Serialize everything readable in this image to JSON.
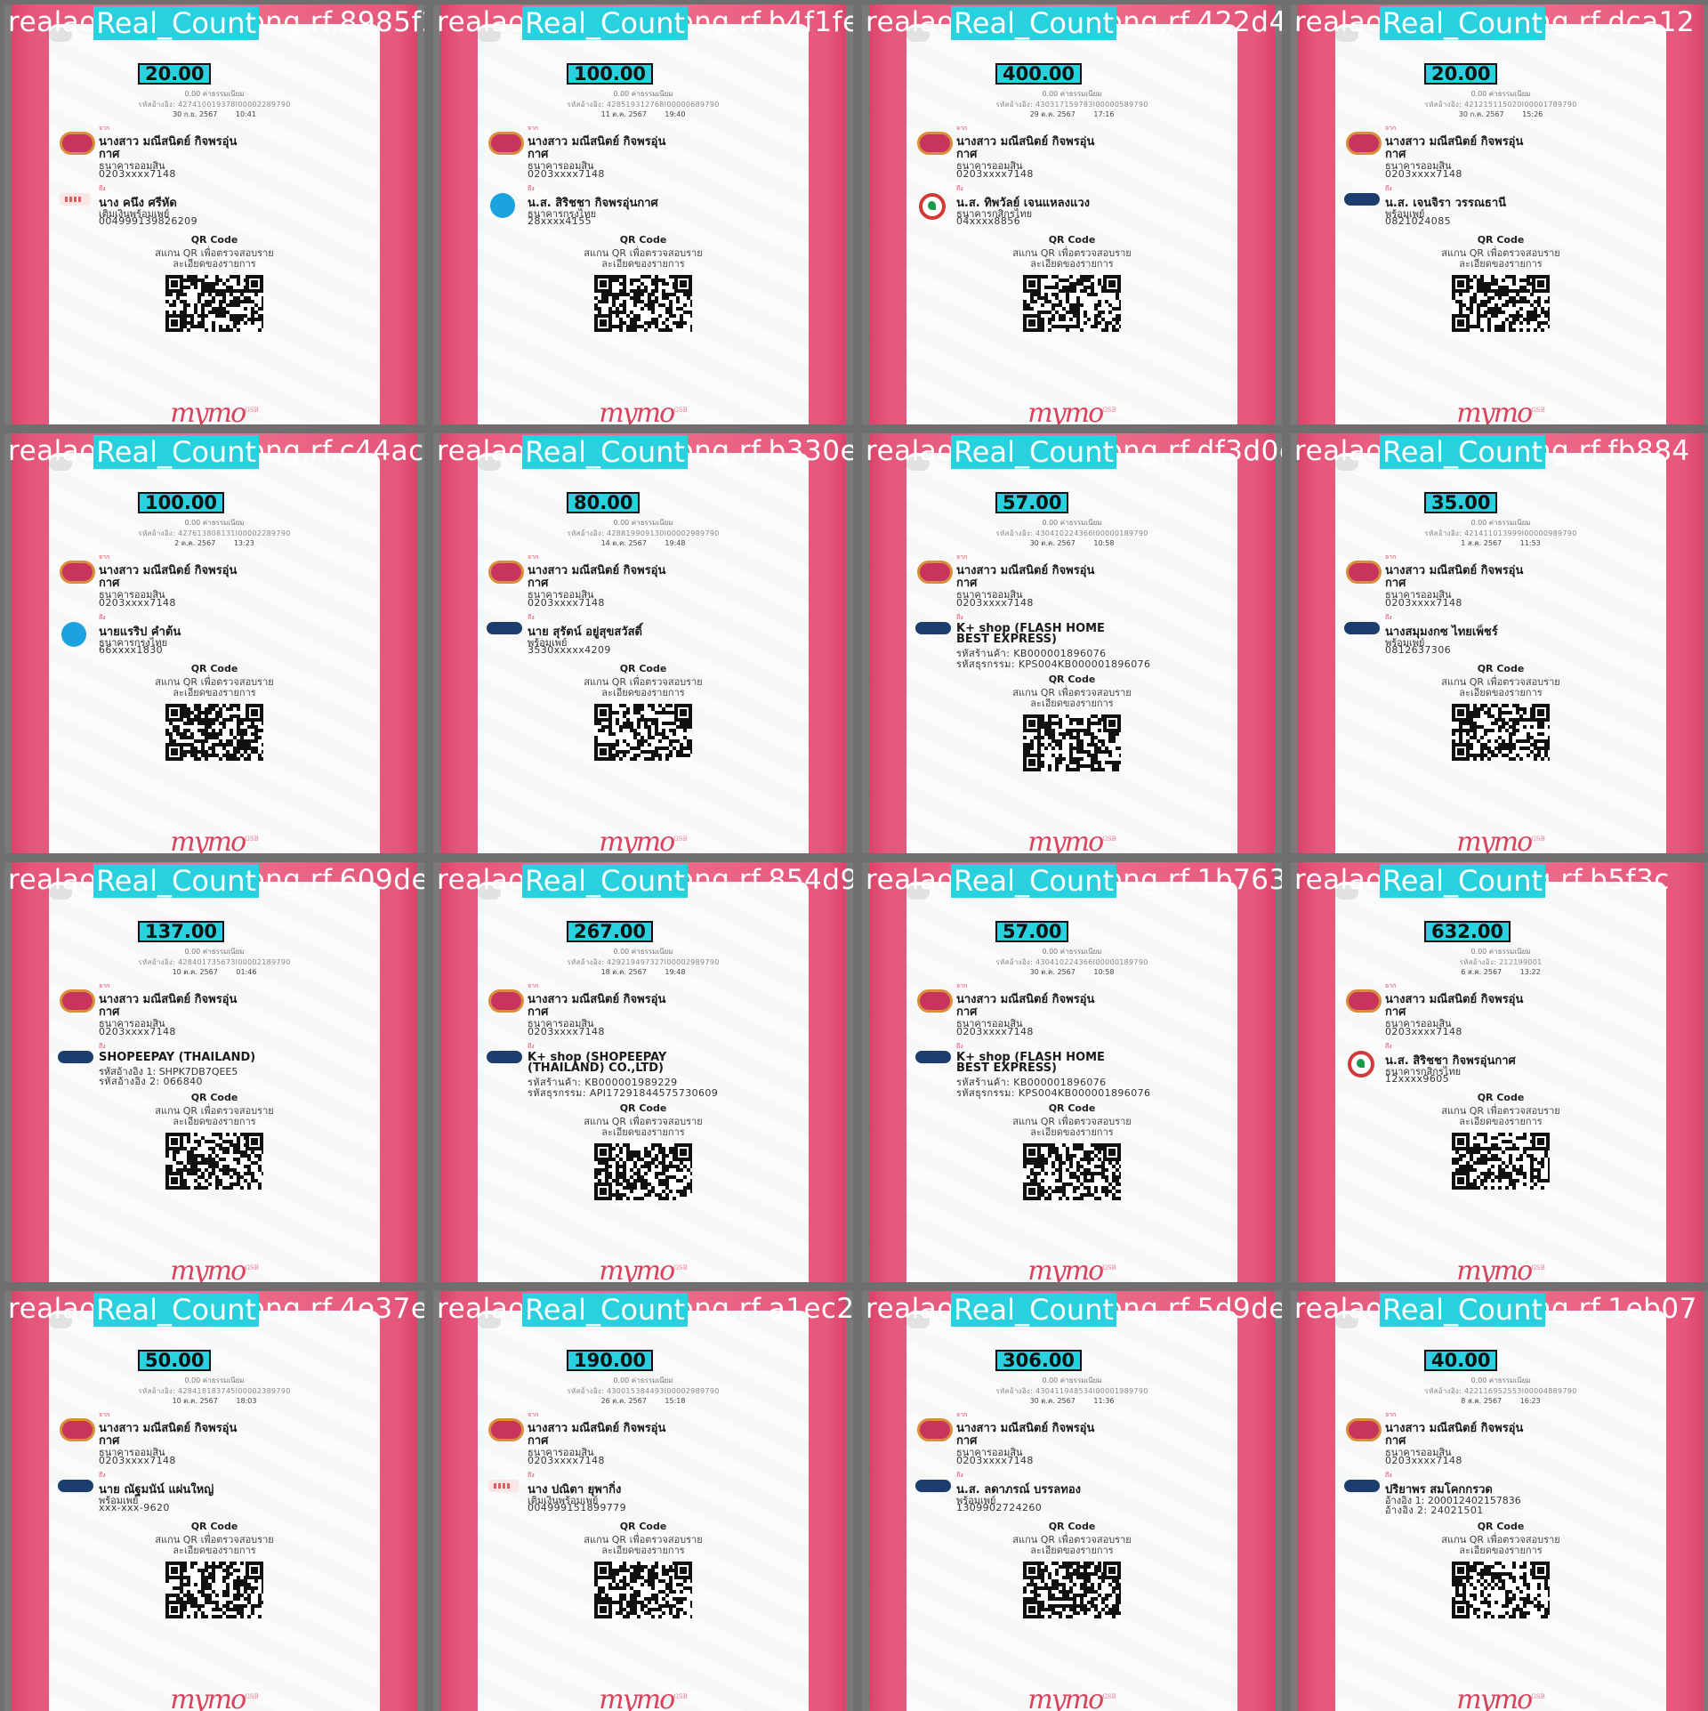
{
  "class_label": "Real_Count",
  "extra_text": "0.00 ค่าธรรมเนียม",
  "from_label": "จาก",
  "to_label": "ถึง",
  "sender": {
    "name_line1": "นางสาว มณีสนิตย์ กิจพรอุ่น",
    "name_line2": "กาศ",
    "bank": "ธนาคารออมสิน",
    "account": "0203xxxx7148"
  },
  "qr_section": {
    "title": "QR Code",
    "desc_line1": "สแกน QR เพื่อตรวจสอบราย",
    "desc_line2": "ละเอียดของรายการ"
  },
  "brand": {
    "name": "mymo",
    "sup": "GSB"
  },
  "tiles": [
    {
      "filename": "realaomsin_173_png.rf.8985f2a7f792af97",
      "amount": "20.00",
      "ref": "รหัสอ้างอิง: 427410019378I00002289790",
      "date": "30 ก.ย. 2567",
      "time": "10:41",
      "recipient_logo": "truemoney",
      "recipient_name": "นาง คนึง ศรีหัด",
      "recipient_line2": "เติมเงินพร้อมเพย์",
      "recipient_line3": "004999139826209",
      "recipient_line4": ""
    },
    {
      "filename": "realaomsin_178_png.rf.b4f1feadb1d4c607",
      "amount": "100.00",
      "ref": "รหัสอ้างอิง: 428519312768I00000689790",
      "date": "11 ต.ค. 2567",
      "time": "19:40",
      "recipient_logo": "ktb",
      "recipient_name": "น.ส. สิริชชา กิจพรอุ่นกาศ",
      "recipient_line2": "ธนาคารกรุงไทย",
      "recipient_line3": "28xxxx4155",
      "recipient_line4": ""
    },
    {
      "filename": "realaomsin_184_png.rf.422d4535a0a9e1b6",
      "amount": "400.00",
      "ref": "รหัสอ้างอิง: 430317159783I00000589790",
      "date": "29 ต.ค. 2567",
      "time": "17:16",
      "recipient_logo": "kbank",
      "recipient_name": "น.ส. ทิพวัลย์ เจนแหลงแวง",
      "recipient_line2": "ธนาคารกสิกรไทย",
      "recipient_line3": "04xxxx8856",
      "recipient_line4": ""
    },
    {
      "filename": "realaomsin_18_png.rf.dca12",
      "amount": "20.00",
      "ref": "รหัสอ้างอิง: 421215115020I00001789790",
      "date": "30 ก.ค. 2567",
      "time": "15:26",
      "recipient_logo": "promptpay",
      "recipient_name": "น.ส. เจนจิรา วรรณธานี",
      "recipient_line2": "พร้อมเพย์",
      "recipient_line3": "0821024085",
      "recipient_line4": ""
    },
    {
      "filename": "realaomsin_186_png.rf.c44ac85eff1923c540",
      "amount": "100.00",
      "ref": "รหัสอ้างอิง: 427613808131I00002289790",
      "date": "2 ต.ค. 2567",
      "time": "13:23",
      "recipient_logo": "ktb",
      "recipient_name": "นายแรริป คำต้น",
      "recipient_line2": "ธนาคารกรุงไทย",
      "recipient_line3": "66xxxx1830",
      "recipient_line4": ""
    },
    {
      "filename": "realaomsin_187_png.rf.b330e75662e1ac195",
      "amount": "80.00",
      "ref": "รหัสอ้างอิง: 428819909130I00002989790",
      "date": "14 ต.ค. 2567",
      "time": "19:48",
      "recipient_logo": "promptpay",
      "recipient_name": "นาย สุรัตน์ อยู่สุขสวัสดิ์",
      "recipient_line2": "พร้อมเพย์",
      "recipient_line3": "3530xxxxx4209",
      "recipient_line4": ""
    },
    {
      "filename": "realaomsin_189_png.rf.df3d0e3f3bf1c8",
      "amount": "57.00",
      "ref": "รหัสอ้างอิง: 430410224366I00000189790",
      "date": "30 ต.ค. 2567",
      "time": "10:58",
      "recipient_logo": "promptpay",
      "recipient_name": "K+ shop (FLASH HOME",
      "recipient_line2": "BEST EXPRESS)",
      "recipient_line3": "รหัสร้านค้า: KB000001896076",
      "recipient_line4": "รหัสธุรกรรม: KPS004KB000001896076"
    },
    {
      "filename": "realaomsin_19_png.rf.fb884",
      "amount": "35.00",
      "ref": "รหัสอ้างอิง: 421411013999I00000989790",
      "date": "1 ส.ค. 2567",
      "time": "11:53",
      "recipient_logo": "promptpay",
      "recipient_name": "นางสมุมงกซ ไทยเพ็ชร์",
      "recipient_line2": "พร้อมเพย์",
      "recipient_line3": "0812637306",
      "recipient_line4": ""
    },
    {
      "filename": "realaomsin_190_png.rf.609de0af2bd7f1620",
      "amount": "137.00",
      "ref": "รหัสอ้างอิง: 428401735673I00002189790",
      "date": "10 ต.ค. 2567",
      "time": "01:46",
      "recipient_logo": "promptpay",
      "recipient_name": "SHOPEEPAY (THAILAND)",
      "recipient_line2": "รหัสอ้างอิง 1: SHPK7DB7QEE5",
      "recipient_line3": "รหัสอ้างอิง 2: 066840",
      "recipient_line4": ""
    },
    {
      "filename": "realaomsin_193_png.rf.854d9e1acb3f3f2a6",
      "amount": "267.00",
      "ref": "รหัสอ้างอิง: 429219497327I00002989790",
      "date": "18 ต.ค. 2567",
      "time": "19:48",
      "recipient_logo": "promptpay",
      "recipient_name": "K+ shop (SHOPEEPAY",
      "recipient_line2": "(THAILAND) CO.,LTD)",
      "recipient_line3": "รหัสร้านค้า: KB000001989229",
      "recipient_line4": "รหัสธุรกรรม: API17291844575730609"
    },
    {
      "filename": "realaomsin_196_png.rf.1b76350abad8e7c1",
      "amount": "57.00",
      "ref": "รหัสอ้างอิง: 430410224366I00000189790",
      "date": "30 ต.ค. 2567",
      "time": "10:58",
      "recipient_logo": "promptpay",
      "recipient_name": "K+ shop (FLASH HOME",
      "recipient_line2": "BEST EXPRESS)",
      "recipient_line3": "รหัสร้านค้า: KB000001896076",
      "recipient_line4": "รหัสธุรกรรม: KPS004KB000001896076"
    },
    {
      "filename": "realaomsin_1_png.rf.b5f3c",
      "amount": "632.00",
      "ref": "รหัสอ้างอิง: 212199001",
      "date": "6 ส.ค. 2567",
      "time": "13:22",
      "recipient_logo": "kbank",
      "recipient_name": "น.ส. สิริชชา กิจพรอุ่นกาศ",
      "recipient_line2": "ธนาคารกสิกรไทย",
      "recipient_line3": "12xxxx9605",
      "recipient_line4": ""
    },
    {
      "filename": "realaomsin_203_png.rf.4e37e10d756f0f2d1",
      "amount": "50.00",
      "ref": "รหัสอ้างอิง: 428418183745I00002389790",
      "date": "10 ต.ค. 2567",
      "time": "18:03",
      "recipient_logo": "promptpay",
      "recipient_name": "นาย ณัฐมนัน์ แผ่นใหญ่",
      "recipient_line2": "พร้อมเพย์",
      "recipient_line3": "xxx-xxx-9620",
      "recipient_line4": ""
    },
    {
      "filename": "realaomsin_205_png.rf.a1ec298a25dd127e9",
      "amount": "190.00",
      "ref": "รหัสอ้างอิง: 430015384493I00002989790",
      "date": "26 ต.ค. 2567",
      "time": "15:18",
      "recipient_logo": "truemoney",
      "recipient_name": "นาง ปณิตา ยุพากิ่ง",
      "recipient_line2": "เติมเงินพร้อมเพย์",
      "recipient_line3": "004999151899779",
      "recipient_line4": ""
    },
    {
      "filename": "realaomsin_207_png.rf.5d9de15ebd6b19354",
      "amount": "306.00",
      "ref": "รหัสอ้างอิง: 430411948534I00001989790",
      "date": "30 ต.ค. 2567",
      "time": "11:36",
      "recipient_logo": "promptpay",
      "recipient_name": "น.ส. ลดาภรณ์ บรรลทอง",
      "recipient_line2": "พร้อมเพย์",
      "recipient_line3": "1309902724260",
      "recipient_line4": ""
    },
    {
      "filename": "realaomsin_21_png.rf.1eb07",
      "amount": "40.00",
      "ref": "รหัสอ้างอิง: 422116952553I00004889790",
      "date": "8 ส.ค. 2567",
      "time": "16:23",
      "recipient_logo": "promptpay",
      "recipient_name": "ปริยาพร สมโคกกรวด",
      "recipient_line2": "อ้างอิง 1: 200012402157836",
      "recipient_line3": "อ้างอิง 2: 24021501",
      "recipient_line4": ""
    }
  ]
}
